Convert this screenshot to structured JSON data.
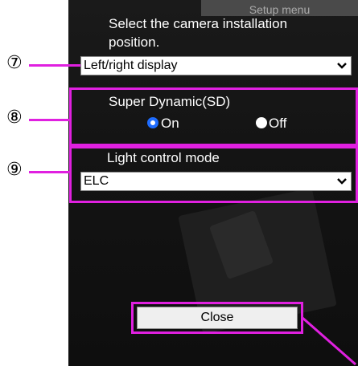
{
  "header": {
    "banner": "Setup menu"
  },
  "installation": {
    "heading_line1": "Select the camera installation",
    "heading_line2": "position.",
    "selected": "Left/right display",
    "marker": "⑦"
  },
  "super_dynamic": {
    "label": "Super Dynamic(SD)",
    "on_label": "On",
    "off_label": "Off",
    "value": "On",
    "marker": "⑧"
  },
  "light_control": {
    "label": "Light control mode",
    "selected": "ELC",
    "marker": "⑨"
  },
  "footer": {
    "close_label": "Close"
  },
  "colors": {
    "callout": "#e020e0",
    "radio_selected": "#1e6cff"
  },
  "icons": [
    "chevron-down-icon",
    "radio-on-icon",
    "radio-off-icon"
  ]
}
